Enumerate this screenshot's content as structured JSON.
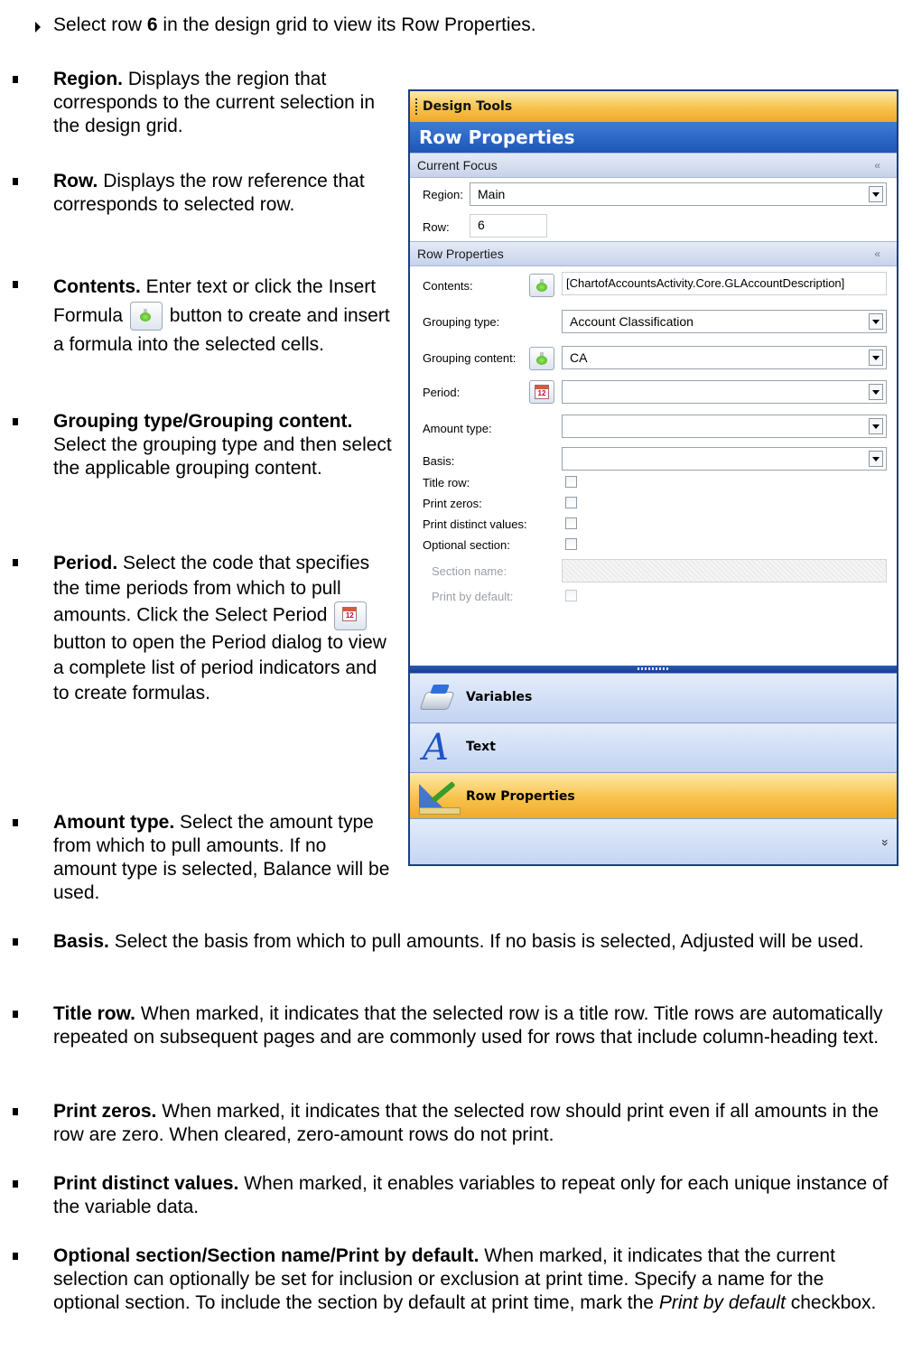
{
  "intro": {
    "pre": "Select row ",
    "row_num": "6",
    "post": " in the design grid to view its Row Properties."
  },
  "bullets": {
    "region": {
      "term": "Region.",
      "desc": " Displays the region that corresponds to the current selection in the design grid."
    },
    "row": {
      "term": "Row.",
      "desc": " Displays the row reference that corresponds to selected row."
    },
    "contents": {
      "term": "Contents.",
      "desc1": " Enter text or click the Insert Formula ",
      "desc2": " button to create and insert a formula into the selected cells."
    },
    "grouping": {
      "term": "Grouping type/Grouping content.",
      "desc": " Select the grouping type and then select the applicable grouping content."
    },
    "period": {
      "term": "Period.",
      "desc1": " Select the code that specifies the time periods from which to pull amounts. Click the Select Period ",
      "desc2": " button to open the Period dialog to view a complete list of period indicators and to create formulas."
    },
    "amount": {
      "term": "Amount type.",
      "desc": " Select the amount type from which to pull amounts. If no amount type is selected, Balance will be used."
    },
    "basis": {
      "term": "Basis.",
      "desc": " Select the basis from which to pull amounts. If no basis is selected, Adjusted will be used."
    },
    "title_row": {
      "term": "Title row.",
      "desc": " When marked, it indicates that the selected row is a title row. Title rows are automatically repeated on subsequent pages and are commonly used for rows that include column-heading text."
    },
    "print_zeros": {
      "term": "Print zeros.",
      "desc": " When marked, it indicates that the selected row should print even if all amounts in the row are zero. When cleared, zero-amount rows do not print."
    },
    "print_distinct": {
      "term": "Print distinct values.",
      "desc": " When marked, it enables variables to repeat only for each unique instance of the variable data."
    },
    "optional": {
      "term": "Optional section/Section name/Print by default.",
      "desc1": " When marked, it indicates that the current selection can optionally be set for inclusion or exclusion at print time. Specify a name for the optional section. To include the section by default at print time, mark the ",
      "em": "Print by default",
      "desc2": " checkbox."
    }
  },
  "panel": {
    "header": "Design Tools",
    "title": "Row Properties",
    "current_focus": "Current Focus",
    "region_label": "Region:",
    "region_value": "Main",
    "row_label": "Row:",
    "row_value": "6",
    "row_props_section": "Row Properties",
    "contents_label": "Contents:",
    "contents_value": "[ChartofAccountsActivity.Core.GLAccountDescription]",
    "grouping_type_label": "Grouping type:",
    "grouping_type_value": "Account Classification",
    "grouping_content_label": "Grouping content:",
    "grouping_content_value": "CA",
    "period_label": "Period:",
    "period_value": "",
    "amount_type_label": "Amount type:",
    "amount_type_value": "",
    "basis_label": "Basis:",
    "basis_value": "",
    "title_row_label": "Title row:",
    "print_zeros_label": "Print zeros:",
    "print_distinct_label": "Print distinct values:",
    "optional_section_label": "Optional section:",
    "section_name_label": "Section name:",
    "print_by_default_label": "Print by default:",
    "nav_variables": "Variables",
    "nav_text": "Text",
    "nav_row_properties": "Row Properties",
    "text_icon_glyph": "A",
    "calendar_num": "12",
    "collapse_glyph": "«",
    "more_glyph": "»"
  }
}
